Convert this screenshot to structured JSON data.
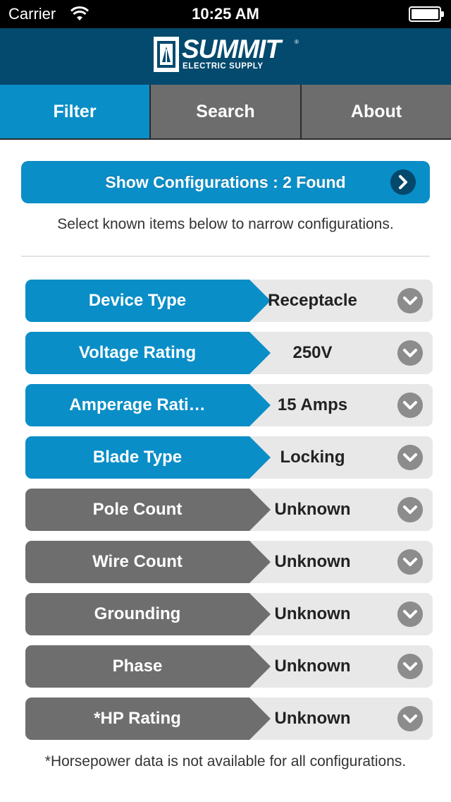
{
  "status_bar": {
    "carrier": "Carrier",
    "time": "10:25 AM",
    "wifi_icon": "wifi-icon",
    "battery_icon": "battery-icon"
  },
  "header": {
    "logo_name": "SUMMIT",
    "logo_subtitle": "ELECTRIC SUPPLY",
    "logo_mark": "®",
    "background": "#044a6e"
  },
  "tabs": [
    {
      "label": "Filter",
      "active": true
    },
    {
      "label": "Search",
      "active": false
    },
    {
      "label": "About",
      "active": false
    }
  ],
  "main": {
    "show_button_label": "Show Configurations : 2 Found",
    "show_button_icon": "chevron-right-icon",
    "hint": "Select known items below to narrow configurations.",
    "footnote": "*Horsepower data is not available for all configurations."
  },
  "filters": [
    {
      "label": "Device Type",
      "value": "Receptacle",
      "state": "known"
    },
    {
      "label": "Voltage Rating",
      "value": "250V",
      "state": "known"
    },
    {
      "label": "Amperage Rati…",
      "value": "15 Amps",
      "state": "known"
    },
    {
      "label": "Blade Type",
      "value": "Locking",
      "state": "known"
    },
    {
      "label": "Pole Count",
      "value": "Unknown",
      "state": "unknown"
    },
    {
      "label": "Wire Count",
      "value": "Unknown",
      "state": "unknown"
    },
    {
      "label": "Grounding",
      "value": "Unknown",
      "state": "unknown"
    },
    {
      "label": "Phase",
      "value": "Unknown",
      "state": "unknown"
    },
    {
      "label": "*HP Rating",
      "value": "Unknown",
      "state": "unknown"
    }
  ],
  "colors": {
    "accent": "#0a8ec7",
    "inactive": "#6e6e6e",
    "tab_inactive": "#6d6d6d"
  }
}
